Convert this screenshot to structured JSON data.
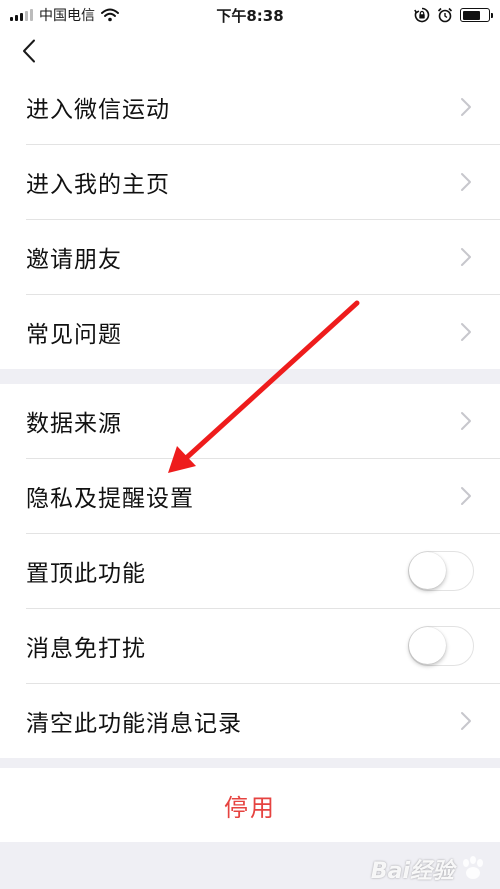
{
  "status_bar": {
    "carrier": "中国电信",
    "time": "下午8:38",
    "icons": [
      "signal-icon",
      "wifi-icon",
      "rotation-lock-icon",
      "alarm-icon",
      "battery-icon"
    ],
    "battery_level": 0.7
  },
  "nav": {
    "back_icon": "chevron-left-icon"
  },
  "group1": {
    "items": [
      {
        "label": "进入微信运动",
        "control": "chevron"
      },
      {
        "label": "进入我的主页",
        "control": "chevron"
      },
      {
        "label": "邀请朋友",
        "control": "chevron"
      },
      {
        "label": "常见问题",
        "control": "chevron"
      }
    ]
  },
  "group2": {
    "items": [
      {
        "label": "数据来源",
        "control": "chevron"
      },
      {
        "label": "隐私及提醒设置",
        "control": "chevron"
      },
      {
        "label": "置顶此功能",
        "control": "toggle",
        "on": false
      },
      {
        "label": "消息免打扰",
        "control": "toggle",
        "on": false
      },
      {
        "label": "清空此功能消息记录",
        "control": "chevron"
      }
    ]
  },
  "disable": {
    "label": "停用"
  },
  "watermark": {
    "text": "Bai经验"
  },
  "colors": {
    "danger": "#e64340",
    "annotation_arrow": "#ee1c1c",
    "background": "#efeff4"
  }
}
